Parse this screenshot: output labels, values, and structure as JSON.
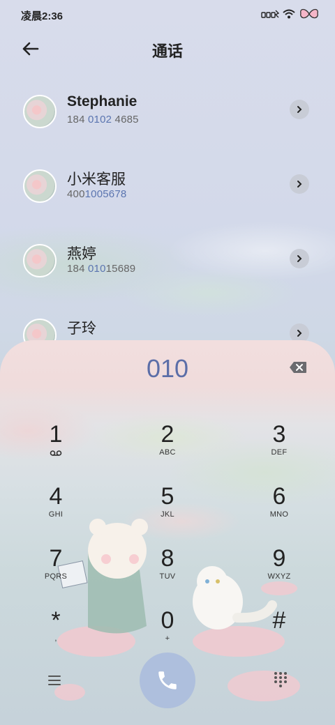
{
  "status": {
    "time": "凌晨2:36"
  },
  "header": {
    "title": "通话"
  },
  "contacts": [
    {
      "name": "Stephanie",
      "num_pre": "184 ",
      "num_hl": "0102",
      "num_post": " 4685"
    },
    {
      "name": "小米客服",
      "num_pre": "400",
      "num_hl": "1005678",
      "num_post": ""
    },
    {
      "name": "燕婷",
      "num_pre": "184 ",
      "num_hl": "010",
      "num_post": "15689"
    },
    {
      "name": "子玲",
      "num_pre": "",
      "num_hl": "",
      "num_post": ""
    }
  ],
  "dialer": {
    "input": "010",
    "keys": [
      {
        "digit": "1",
        "letters": ""
      },
      {
        "digit": "2",
        "letters": "ABC"
      },
      {
        "digit": "3",
        "letters": "DEF"
      },
      {
        "digit": "4",
        "letters": "GHI"
      },
      {
        "digit": "5",
        "letters": "JKL"
      },
      {
        "digit": "6",
        "letters": "MNO"
      },
      {
        "digit": "7",
        "letters": "PQRS"
      },
      {
        "digit": "8",
        "letters": "TUV"
      },
      {
        "digit": "9",
        "letters": "WXYZ"
      },
      {
        "digit": "*",
        "letters": ","
      },
      {
        "digit": "0",
        "letters": "+"
      },
      {
        "digit": "#",
        "letters": ""
      }
    ]
  },
  "colors": {
    "accent": "#5b6ea8",
    "call_button": "#aebfdd"
  },
  "icons": {
    "key1_sub": "voicemail-icon",
    "call": "phone-icon",
    "menu": "menu-icon",
    "dialpad": "dialpad-icon"
  }
}
